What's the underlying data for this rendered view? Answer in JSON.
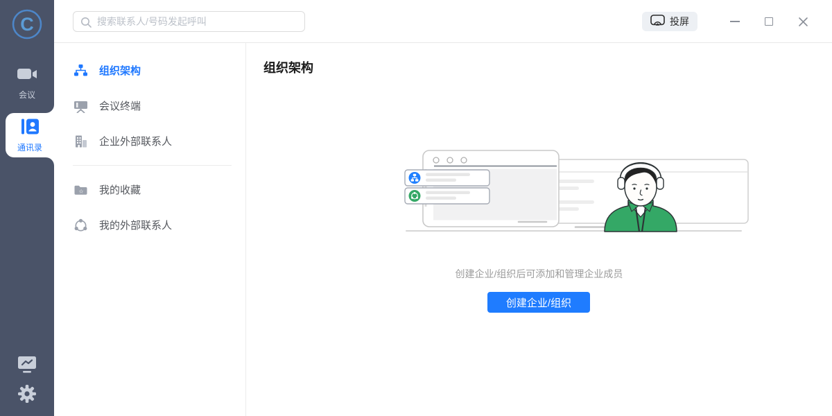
{
  "app": {
    "logo_letter": "C"
  },
  "colors": {
    "accent_blue": "#1f78ff",
    "sidebar_dark": "#4a5368",
    "brand_green": "#34a866"
  },
  "icons": {
    "logo": "circle-C",
    "meeting": "video-camera",
    "contacts": "address-book",
    "stats": "monitor-chart",
    "settings": "gear",
    "search": "magnifier",
    "cast": "screen-cast",
    "minimize": "minus",
    "maximize": "square",
    "close": "cross",
    "org": "org-chart",
    "terminal": "whiteboard",
    "external_company": "buildings",
    "favorites": "folder-star",
    "external_contacts": "network-circle"
  },
  "sidebar": {
    "items": [
      {
        "label": "会议",
        "selected": false
      },
      {
        "label": "通讯录",
        "selected": true
      }
    ]
  },
  "topbar": {
    "search_placeholder": "搜索联系人/号码发起呼叫",
    "cast_label": "投屏"
  },
  "nav": {
    "items": [
      {
        "label": "组织架构",
        "selected": true
      },
      {
        "label": "会议终端",
        "selected": false
      },
      {
        "label": "企业外部联系人",
        "selected": false
      },
      {
        "label": "我的收藏",
        "selected": false
      },
      {
        "label": "我的外部联系人",
        "selected": false
      }
    ]
  },
  "main": {
    "title": "组织架构",
    "empty_hint": "创建企业/组织后可添加和管理企业成员",
    "create_button_label": "创建企业/组织"
  }
}
